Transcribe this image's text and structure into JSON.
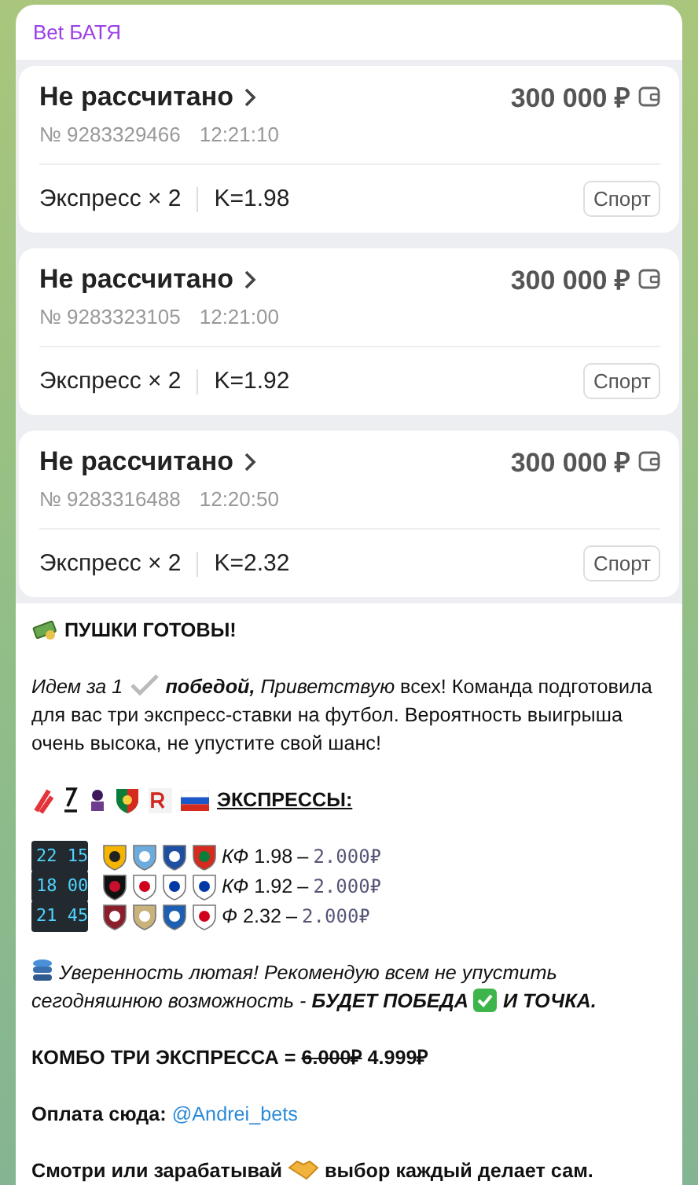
{
  "sender": "Bet БАТЯ",
  "bets": [
    {
      "status": "Не рассчитано",
      "amount": "300 000 ₽",
      "number": "№ 9283329466",
      "time": "12:21:10",
      "type": "Экспресс × 2",
      "coef": "K=1.98",
      "tag": "Спорт"
    },
    {
      "status": "Не рассчитано",
      "amount": "300 000 ₽",
      "number": "№ 9283323105",
      "time": "12:21:00",
      "type": "Экспресс × 2",
      "coef": "K=1.92",
      "tag": "Спорт"
    },
    {
      "status": "Не рассчитано",
      "amount": "300 000 ₽",
      "number": "№ 9283316488",
      "time": "12:20:50",
      "type": "Экспресс × 2",
      "coef": "K=2.32",
      "tag": "Спорт"
    }
  ],
  "message": {
    "headline": "ПУШКИ ГОТОВЫ!",
    "intro_lead": "Идем за 1",
    "intro_text": "**победой,** *Приветствую* всех! Команда подготовила для вас три экспресс-ставки на футбол. Вероятность выигрыша очень высока, не упустите свой шанс!",
    "expresses_title": "ЭКСПРЕССЫ:",
    "expresses": [
      {
        "clock": "22 15",
        "coef": "*КФ* 1.98",
        "dash": "–",
        "price": "2.000₽"
      },
      {
        "clock": "18 00",
        "coef": "*КФ* 1.92",
        "dash": "–",
        "price": "2.000₽"
      },
      {
        "clock": "21 45",
        "coef": "*Ф* 2.32",
        "dash": "–",
        "price": "2.000₽"
      }
    ],
    "confidence": "Уверенность лютая! Рекомендую всем не упустить сегодняшнюю возможность - **БУДЕТ ПОБЕДА**",
    "confidence_end": "И ТОЧКА.",
    "combo_label": "КОМБО ТРИ ЭКСПРЕССА =",
    "combo_old_price": "6.000₽",
    "combo_price": "4.999₽",
    "payment_label": "Оплата сюда:",
    "payment_link": "@Andrei_bets",
    "closing_lead": "Смотри или зарабатывай",
    "closing_text": "выбор каждый делает сам."
  }
}
